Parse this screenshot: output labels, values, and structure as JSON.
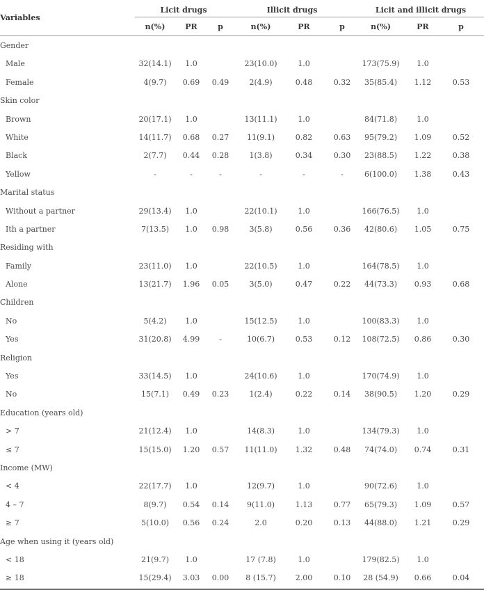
{
  "table": {
    "variables_header": "Variables",
    "groups": [
      "Licit drugs",
      "Illicit drugs",
      "Licit and illicit drugs"
    ],
    "subheaders": [
      "n(%)",
      "PR",
      "p",
      "n(%)",
      "PR",
      "p",
      "n(%)",
      "PR",
      "p"
    ],
    "rows": [
      {
        "type": "category",
        "label": "Gender"
      },
      {
        "type": "sub",
        "label": "Male",
        "cells": [
          "32(14.1)",
          "1.0",
          "",
          "23(10.0)",
          "1.0",
          "",
          "173(75.9)",
          "1.0",
          ""
        ]
      },
      {
        "type": "sub",
        "label": "Female",
        "cells": [
          "4(9.7)",
          "0.69",
          "0.49",
          "2(4.9)",
          "0.48",
          "0.32",
          "35(85.4)",
          "1.12",
          "0.53"
        ]
      },
      {
        "type": "category",
        "label": "Skin color"
      },
      {
        "type": "sub",
        "label": "Brown",
        "cells": [
          "20(17.1)",
          "1.0",
          "",
          "13(11.1)",
          "1.0",
          "",
          "84(71.8)",
          "1.0",
          ""
        ]
      },
      {
        "type": "sub",
        "label": "White",
        "cells": [
          "14(11.7)",
          "0.68",
          "0.27",
          "11(9.1)",
          "0.82",
          "0.63",
          "95(79.2)",
          "1.09",
          "0.52"
        ]
      },
      {
        "type": "sub",
        "label": "Black",
        "cells": [
          "2(7.7)",
          "0.44",
          "0.28",
          "1(3.8)",
          "0.34",
          "0.30",
          "23(88.5)",
          "1.22",
          "0.38"
        ]
      },
      {
        "type": "sub",
        "label": "Yellow",
        "cells": [
          "-",
          "-",
          "-",
          "-",
          "-",
          "-",
          "6(100.0)",
          "1.38",
          "0.43"
        ]
      },
      {
        "type": "category",
        "label": "Marital status"
      },
      {
        "type": "sub",
        "label": "Without a partner",
        "cells": [
          "29(13.4)",
          "1.0",
          "",
          "22(10.1)",
          "1.0",
          "",
          "166(76.5)",
          "1.0",
          ""
        ]
      },
      {
        "type": "sub",
        "label": "Ith a partner",
        "cells": [
          "7(13.5)",
          "1.0",
          "0.98",
          "3(5.8)",
          "0.56",
          "0.36",
          "42(80.6)",
          "1.05",
          "0.75"
        ]
      },
      {
        "type": "category",
        "label": "Residing with"
      },
      {
        "type": "sub",
        "label": "Family",
        "cells": [
          "23(11.0)",
          "1.0",
          "",
          "22(10.5)",
          "1.0",
          "",
          "164(78.5)",
          "1.0",
          ""
        ]
      },
      {
        "type": "sub",
        "label": "Alone",
        "cells": [
          "13(21.7)",
          "1.96",
          "0.05",
          "3(5.0)",
          "0.47",
          "0.22",
          "44(73.3)",
          "0.93",
          "0.68"
        ]
      },
      {
        "type": "category",
        "label": "Children"
      },
      {
        "type": "sub",
        "label": "No",
        "cells": [
          "5(4.2)",
          "1.0",
          "",
          "15(12.5)",
          "1.0",
          "",
          "100(83.3)",
          "1.0",
          ""
        ]
      },
      {
        "type": "sub",
        "label": "Yes",
        "cells": [
          "31(20.8)",
          "4.99",
          "-",
          "10(6.7)",
          "0.53",
          "0.12",
          "108(72.5)",
          "0.86",
          "0.30"
        ]
      },
      {
        "type": "category",
        "label": "Religion"
      },
      {
        "type": "sub",
        "label": "Yes",
        "cells": [
          "33(14.5)",
          "1.0",
          "",
          "24(10.6)",
          "1.0",
          "",
          "170(74.9)",
          "1.0",
          ""
        ]
      },
      {
        "type": "sub",
        "label": "No",
        "cells": [
          "15(7.1)",
          "0.49",
          "0.23",
          "1(2.4)",
          "0.22",
          "0.14",
          "38(90.5)",
          "1.20",
          "0.29"
        ]
      },
      {
        "type": "category",
        "label": "Education (years old)"
      },
      {
        "type": "sub",
        "label": "> 7",
        "cells": [
          "21(12.4)",
          "1.0",
          "",
          "14(8.3)",
          "1.0",
          "",
          "134(79.3)",
          "1.0",
          ""
        ]
      },
      {
        "type": "sub",
        "label": "≤ 7",
        "cells": [
          "15(15.0)",
          "1.20",
          "0.57",
          "11(11.0)",
          "1.32",
          "0.48",
          "74(74.0)",
          "0.74",
          "0.31"
        ]
      },
      {
        "type": "category",
        "label": "Income (MW)"
      },
      {
        "type": "sub",
        "label": "< 4",
        "cells": [
          "22(17.7)",
          "1.0",
          "",
          "12(9.7)",
          "1.0",
          "",
          "90(72.6)",
          "1.0",
          ""
        ]
      },
      {
        "type": "sub",
        "label": "4 – 7",
        "cells": [
          "8(9.7)",
          "0.54",
          "0.14",
          "9(11.0)",
          "1.13",
          "0.77",
          "65(79.3)",
          "1.09",
          "0.57"
        ]
      },
      {
        "type": "sub",
        "label": "≥ 7",
        "cells": [
          "5(10.0)",
          "0.56",
          "0.24",
          "2.0",
          "0.20",
          "0.13",
          "44(88.0)",
          "1.21",
          "0.29"
        ]
      },
      {
        "type": "category",
        "label": "Age when using it (years old)"
      },
      {
        "type": "sub",
        "label": "< 18",
        "cells": [
          "21(9.7)",
          "1.0",
          "",
          "17 (7.8)",
          "1.0",
          "",
          "179(82.5)",
          "1.0",
          ""
        ]
      },
      {
        "type": "sub",
        "label": "≥ 18",
        "cells": [
          "15(29.4)",
          "3.03",
          "0.00",
          "8 (15.7)",
          "2.00",
          "0.10",
          "28 (54.9)",
          "0.66",
          "0.04"
        ]
      }
    ]
  }
}
